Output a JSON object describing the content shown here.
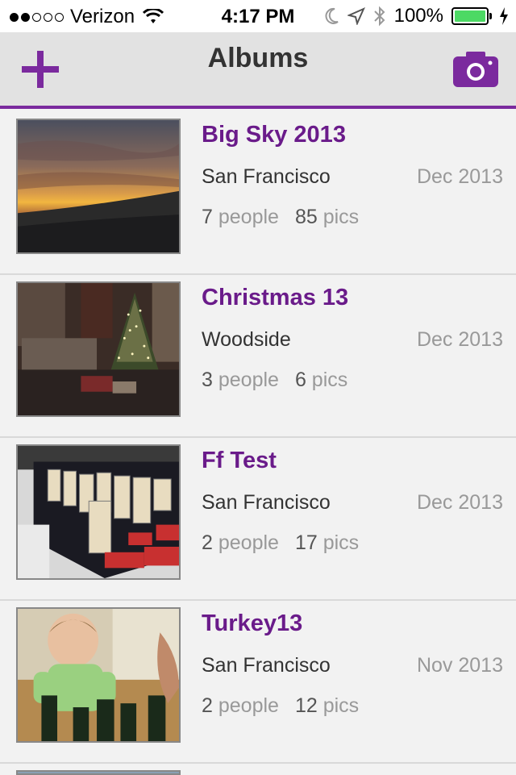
{
  "status_bar": {
    "carrier": "Verizon",
    "time": "4:17 PM",
    "battery": "100%"
  },
  "nav": {
    "title": "Albums",
    "add_icon": "plus-icon",
    "camera_icon": "camera-icon"
  },
  "colors": {
    "accent": "#6a1b8a",
    "nav_bg": "#e2e2e2",
    "battery": "#4cd964"
  },
  "albums": [
    {
      "title": "Big Sky 2013",
      "location": "San Francisco",
      "date": "Dec 2013",
      "people_count": "7",
      "people_label": "people",
      "pics_count": "85",
      "pics_label": "pics"
    },
    {
      "title": "Christmas 13",
      "location": "Woodside",
      "date": "Dec 2013",
      "people_count": "3",
      "people_label": "people",
      "pics_count": "6",
      "pics_label": "pics"
    },
    {
      "title": "Ff Test",
      "location": "San Francisco",
      "date": "Dec 2013",
      "people_count": "2",
      "people_label": "people",
      "pics_count": "17",
      "pics_label": "pics"
    },
    {
      "title": "Turkey13",
      "location": "San Francisco",
      "date": "Nov 2013",
      "people_count": "2",
      "people_label": "people",
      "pics_count": "12",
      "pics_label": "pics"
    }
  ]
}
